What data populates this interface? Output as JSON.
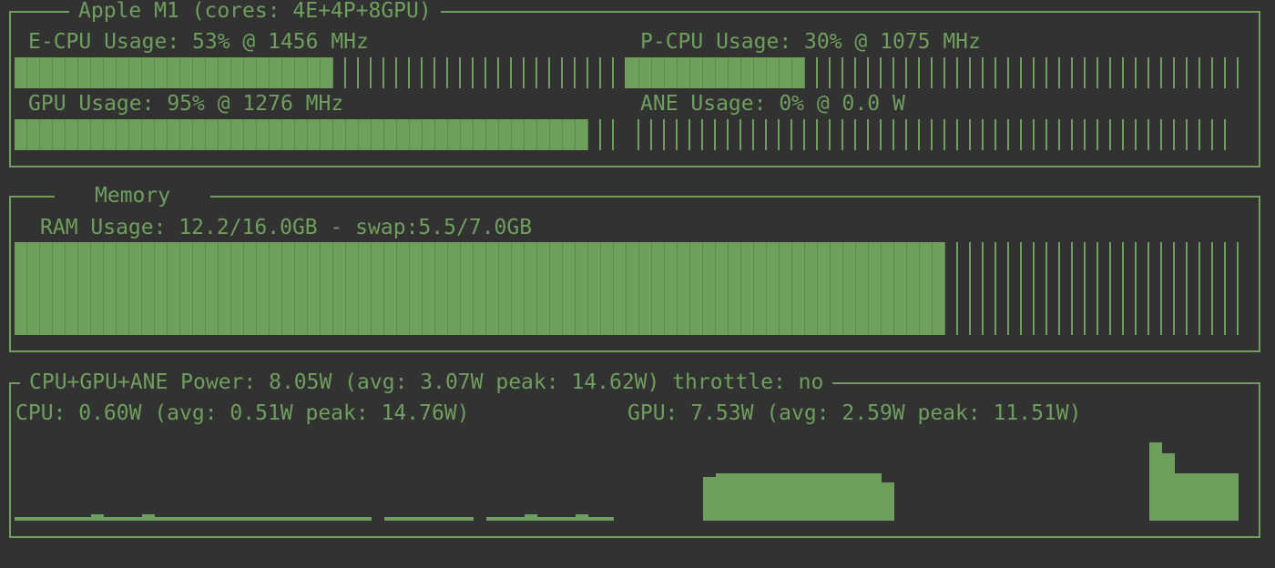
{
  "soc": {
    "title": "Apple M1 (cores: 4E+4P+8GPU)",
    "ecpu": {
      "label": "E-CPU Usage: 53% @ 1456 MHz",
      "percent": 53
    },
    "pcpu": {
      "label": "P-CPU Usage: 30% @ 1075 MHz",
      "percent": 30
    },
    "gpu": {
      "label": "GPU Usage: 95% @ 1276 MHz",
      "percent": 95
    },
    "ane": {
      "label": "ANE Usage: 0% @ 0.0 W",
      "percent": 0
    }
  },
  "memory": {
    "title": "Memory",
    "ram": {
      "label": "RAM Usage: 12.2/16.0GB - swap:5.5/7.0GB",
      "percent": 76
    }
  },
  "power": {
    "title": "CPU+GPU+ANE Power: 8.05W (avg: 3.07W peak: 14.62W) throttle: no",
    "cpu": {
      "label": "CPU: 0.60W (avg: 0.51W peak: 14.76W)",
      "history": [
        0.2,
        0.2,
        0.2,
        0.2,
        0.2,
        0.2,
        0.35,
        0.2,
        0.2,
        0.2,
        0.35,
        0.2,
        0.2,
        0.2,
        0.2,
        0.2,
        0.2,
        0.2,
        0.2,
        0.2,
        0.2,
        0.2,
        0.2,
        0.2,
        0.2,
        0.2,
        0.2,
        0.2,
        null,
        0.2,
        0.2,
        0.2,
        0.2,
        0.2,
        0.2,
        0.2,
        null,
        0.2,
        0.2,
        0.2,
        0.35,
        0.2,
        0.2,
        0.2,
        0.35,
        0.2,
        0.2
      ]
    },
    "gpu": {
      "label": "GPU: 7.53W (avg: 2.59W peak: 11.51W)",
      "history": [
        2.4,
        2.6,
        2.6,
        2.6,
        2.6,
        2.6,
        2.6,
        2.6,
        2.6,
        2.6,
        2.6,
        2.6,
        2.6,
        2.6,
        2.1,
        null,
        null,
        null,
        null,
        null,
        null,
        null,
        null,
        null,
        null,
        null,
        null,
        null,
        null,
        null,
        null,
        null,
        null,
        null,
        null,
        4.3,
        3.7,
        2.6,
        2.6,
        2.6,
        2.6,
        2.6
      ]
    },
    "accent": "#6f9f5d",
    "background": "#323232"
  }
}
